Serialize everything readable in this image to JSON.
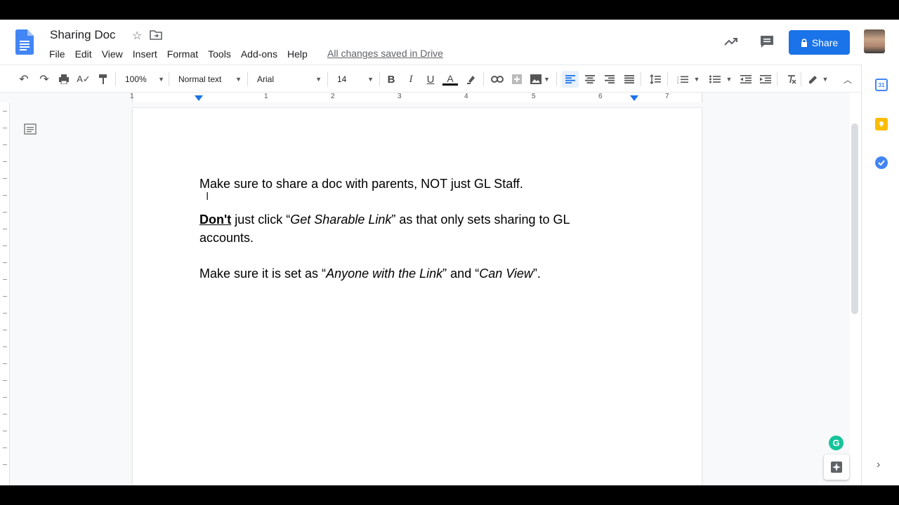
{
  "document": {
    "title": "Sharing Doc",
    "save_status": "All changes saved in Drive"
  },
  "menu": [
    "File",
    "Edit",
    "View",
    "Insert",
    "Format",
    "Tools",
    "Add-ons",
    "Help"
  ],
  "share": {
    "label": "Share"
  },
  "toolbar": {
    "zoom": "100%",
    "style": "Normal text",
    "font": "Arial",
    "size": "14"
  },
  "ruler": {
    "labels": [
      "1",
      "1",
      "2",
      "3",
      "4",
      "5",
      "6",
      "7"
    ]
  },
  "content": {
    "p1": "Make sure to share a doc with parents, NOT just GL Staff.",
    "p2": {
      "bold": "Don't",
      "t1": " just click “",
      "italic1": "Get Sharable Link",
      "t2": "” as that only sets sharing to GL accounts."
    },
    "p3": {
      "t1": "Make sure it is set as “",
      "italic1": "Anyone with the Link",
      "t2": "” and “",
      "italic2": "Can View",
      "t3": "”."
    }
  },
  "colors": {
    "accent": "#1a73e8",
    "docs_blue": "#4285f4",
    "grammarly": "#15c39a",
    "keep": "#fbbc04"
  },
  "side_panel": {
    "calendar_day": "31"
  },
  "grammarly_letter": "G"
}
